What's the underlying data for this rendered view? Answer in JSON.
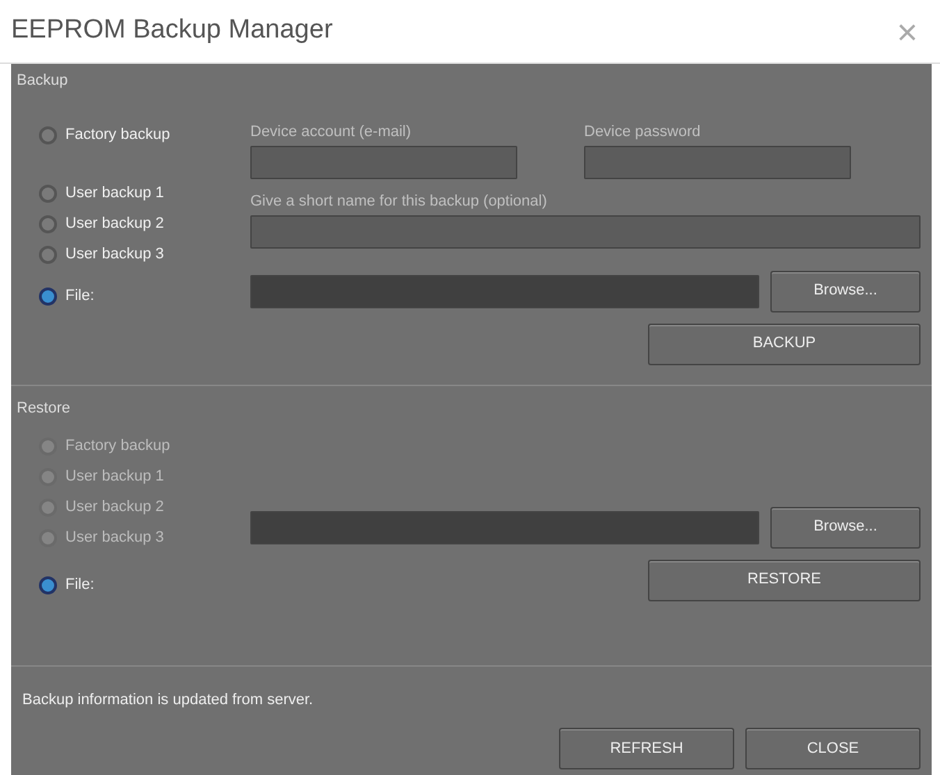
{
  "window": {
    "title": "EEPROM Backup Manager",
    "close": "×"
  },
  "backup": {
    "title": "Backup",
    "options": [
      {
        "label": "Factory backup",
        "selected": false,
        "disabled": false
      },
      {
        "label": "User backup 1",
        "selected": false,
        "disabled": false
      },
      {
        "label": "User backup 2",
        "selected": false,
        "disabled": false
      },
      {
        "label": "User backup 3",
        "selected": false,
        "disabled": false
      },
      {
        "label": "File:",
        "selected": true,
        "disabled": false
      }
    ],
    "account_label": "Device account (e-mail)",
    "password_label": "Device password",
    "name_label": "Give a short name for this backup (optional)",
    "browse": "Browse...",
    "action": "BACKUP"
  },
  "restore": {
    "title": "Restore",
    "options": [
      {
        "label": "Factory backup",
        "selected": false,
        "disabled": true
      },
      {
        "label": "User backup 1",
        "selected": false,
        "disabled": true
      },
      {
        "label": "User backup 2",
        "selected": false,
        "disabled": true
      },
      {
        "label": "User backup 3",
        "selected": false,
        "disabled": true
      },
      {
        "label": "File:",
        "selected": true,
        "disabled": false
      }
    ],
    "browse": "Browse...",
    "action": "RESTORE"
  },
  "status": "Backup information is updated from server.",
  "buttons": [
    "REFRESH",
    "CLOSE"
  ]
}
